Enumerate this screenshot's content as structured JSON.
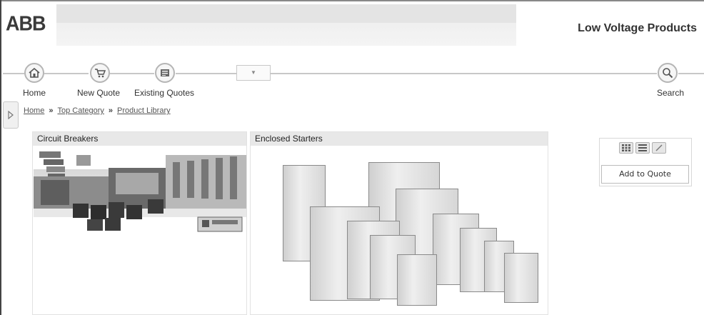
{
  "brand": {
    "logo_text": "ABB",
    "app_title": "Low Voltage Products"
  },
  "nav": {
    "items": [
      {
        "label": "Home",
        "icon": "home-icon"
      },
      {
        "label": "New Quote",
        "icon": "cart-icon"
      },
      {
        "label": "Existing Quotes",
        "icon": "quotes-icon"
      }
    ],
    "dropdown_icon": "chevron-down-icon",
    "search": {
      "label": "Search",
      "icon": "search-icon"
    }
  },
  "breadcrumb": [
    "Home",
    "Top Category",
    "Product Library"
  ],
  "categories": [
    {
      "title": "Circuit Breakers",
      "image": "circuit-breakers-image"
    },
    {
      "title": "Enclosed Starters",
      "image": "enclosed-starters-image"
    }
  ],
  "toolbox": {
    "view_icons": [
      "grid-view-icon",
      "list-view-icon",
      "edit-icon"
    ],
    "add_to_quote_label": "Add to Quote"
  }
}
